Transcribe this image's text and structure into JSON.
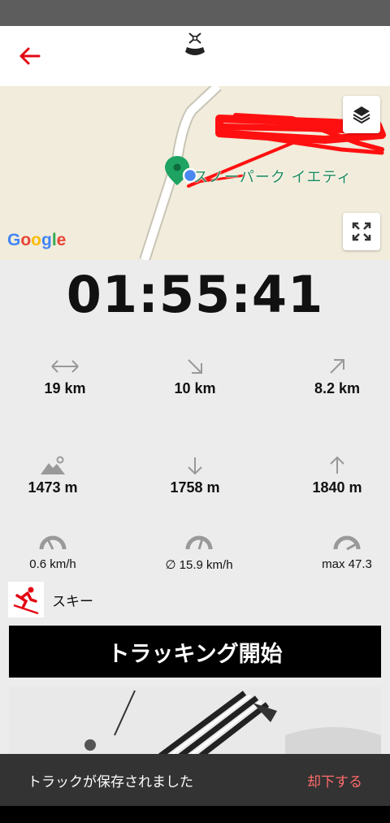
{
  "header": {
    "back_icon": "arrow-left-icon",
    "logo_icon": "ski-logo-icon"
  },
  "map": {
    "place_label": "スノーパーク イエティ",
    "google_logo": "Google",
    "layers_icon": "layers-icon",
    "fullscreen_icon": "fullscreen-icon"
  },
  "timer": "01:55:41",
  "stats": {
    "row1": [
      {
        "icon": "horizontal-distance-icon",
        "value": "19 km"
      },
      {
        "icon": "downhill-distance-icon",
        "value": "10 km"
      },
      {
        "icon": "uphill-distance-icon",
        "value": "8.2 km"
      }
    ],
    "row2": [
      {
        "icon": "altitude-icon",
        "value": "1473 m"
      },
      {
        "icon": "descent-icon",
        "value": "1758 m"
      },
      {
        "icon": "ascent-icon",
        "value": "1840 m"
      }
    ],
    "row3": [
      {
        "icon": "speed-gauge-icon",
        "value": "0.6 km/h"
      },
      {
        "icon": "avg-speed-gauge-icon",
        "value": "∅ 15.9 km/h"
      },
      {
        "icon": "max-speed-gauge-icon",
        "value": "max 47.3"
      }
    ]
  },
  "activity": {
    "icon": "skier-icon",
    "label": "スキー"
  },
  "tracking_button": "トラッキング開始",
  "snackbar": {
    "message": "トラックが保存されました",
    "action": "却下する"
  },
  "colors": {
    "accent": "#e30613",
    "snackbar_action": "#ff6b6b",
    "map_background": "#f1ecdb"
  }
}
